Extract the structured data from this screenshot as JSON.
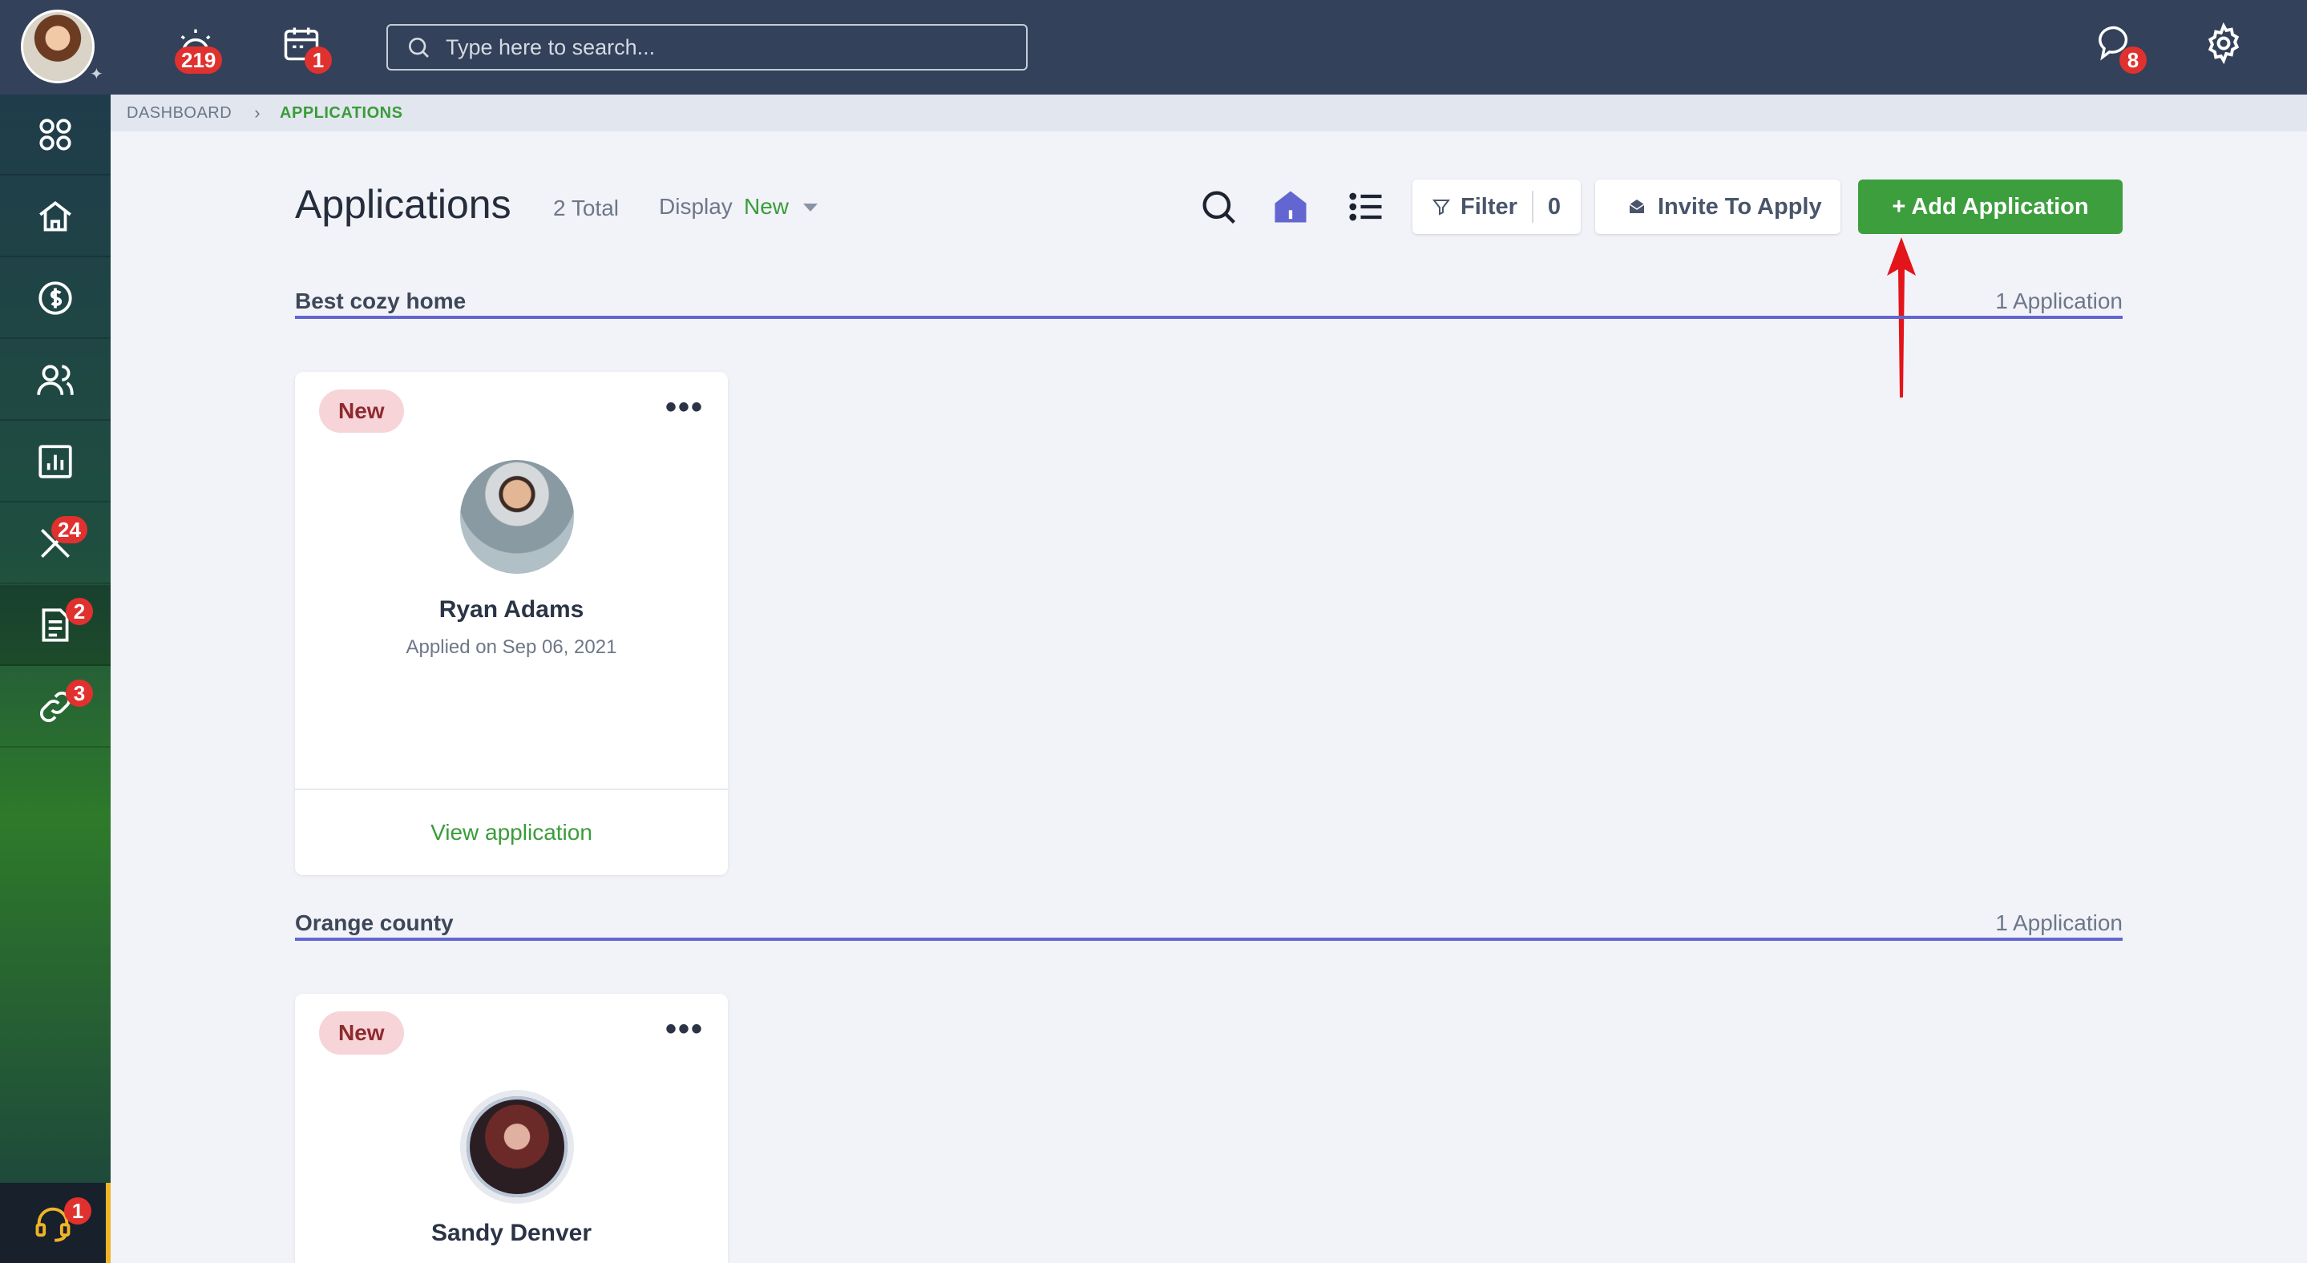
{
  "topbar": {
    "alerts_badge": "219",
    "calendar_badge": "1",
    "search_placeholder": "Type here to search...",
    "messages_badge": "8"
  },
  "sidebar": {
    "items": [
      {
        "name": "apps",
        "badge": ""
      },
      {
        "name": "home",
        "badge": ""
      },
      {
        "name": "money",
        "badge": ""
      },
      {
        "name": "people",
        "badge": ""
      },
      {
        "name": "reports",
        "badge": ""
      },
      {
        "name": "tools",
        "badge": "24"
      },
      {
        "name": "applications",
        "badge": "2"
      },
      {
        "name": "links",
        "badge": "3"
      }
    ],
    "support_badge": "1"
  },
  "breadcrumb": {
    "root": "DASHBOARD",
    "current": "APPLICATIONS"
  },
  "header": {
    "title": "Applications",
    "total": "2 Total",
    "display_label": "Display",
    "display_value": "New"
  },
  "toolbar": {
    "filter_label": "Filter",
    "filter_count": "0",
    "invite_label": "Invite To Apply",
    "add_label": "+  Add Application"
  },
  "groups": [
    {
      "name": "Best cozy home",
      "count": "1 Application",
      "cards": [
        {
          "status": "New",
          "name": "Ryan Adams",
          "applied": "Applied on Sep 06, 2021",
          "link": "View application"
        }
      ]
    },
    {
      "name": "Orange county",
      "count": "1 Application",
      "cards": [
        {
          "status": "New",
          "name": "Sandy Denver"
        }
      ]
    }
  ],
  "colors": {
    "accent": "#3d9e3d",
    "topbar": "#33415a",
    "badge": "#e0312f",
    "divider": "#6366d0"
  }
}
